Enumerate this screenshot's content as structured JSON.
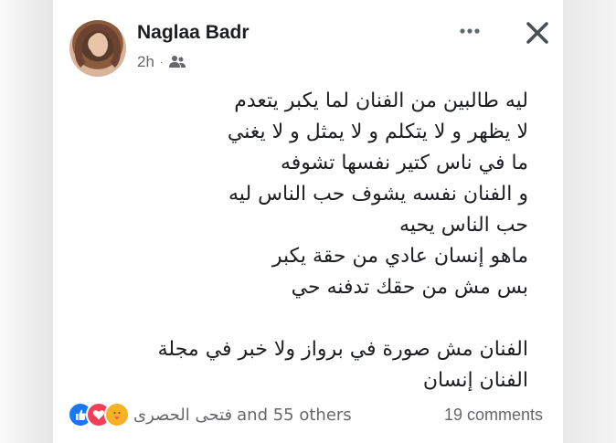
{
  "author": {
    "name": "Naglaa Badr",
    "time": "2h"
  },
  "icons": {
    "privacy": "friends-icon",
    "more": "more-options-icon",
    "close": "close-icon",
    "reactions": [
      "like-icon",
      "love-icon",
      "care-icon"
    ]
  },
  "post": {
    "lines": [
      "ليه طالبين من الفنان لما يكبر يتعدم",
      "لا يظهر و لا يتكلم و لا يمثل و لا يغني",
      "ما في ناس كتير نفسها تشوفه",
      "و الفنان نفسه يشوف حب الناس ليه",
      "حب الناس يحيه",
      "ماهو إنسان عادي من حقة يكبر",
      "بس مش من حقك تدفنه حي",
      "",
      "الفنان مش صورة في برواز ولا خبر في مجلة",
      "الفنان إنسان"
    ]
  },
  "footer": {
    "reactor_name": "فتحى الحصرى",
    "reactors_suffix": "and 55 others",
    "comments": "19 comments"
  },
  "colors": {
    "like": "#1877f2",
    "love": "#f33e58",
    "care": "#f7b125",
    "text": "#1c1e21",
    "muted": "#65676b"
  }
}
